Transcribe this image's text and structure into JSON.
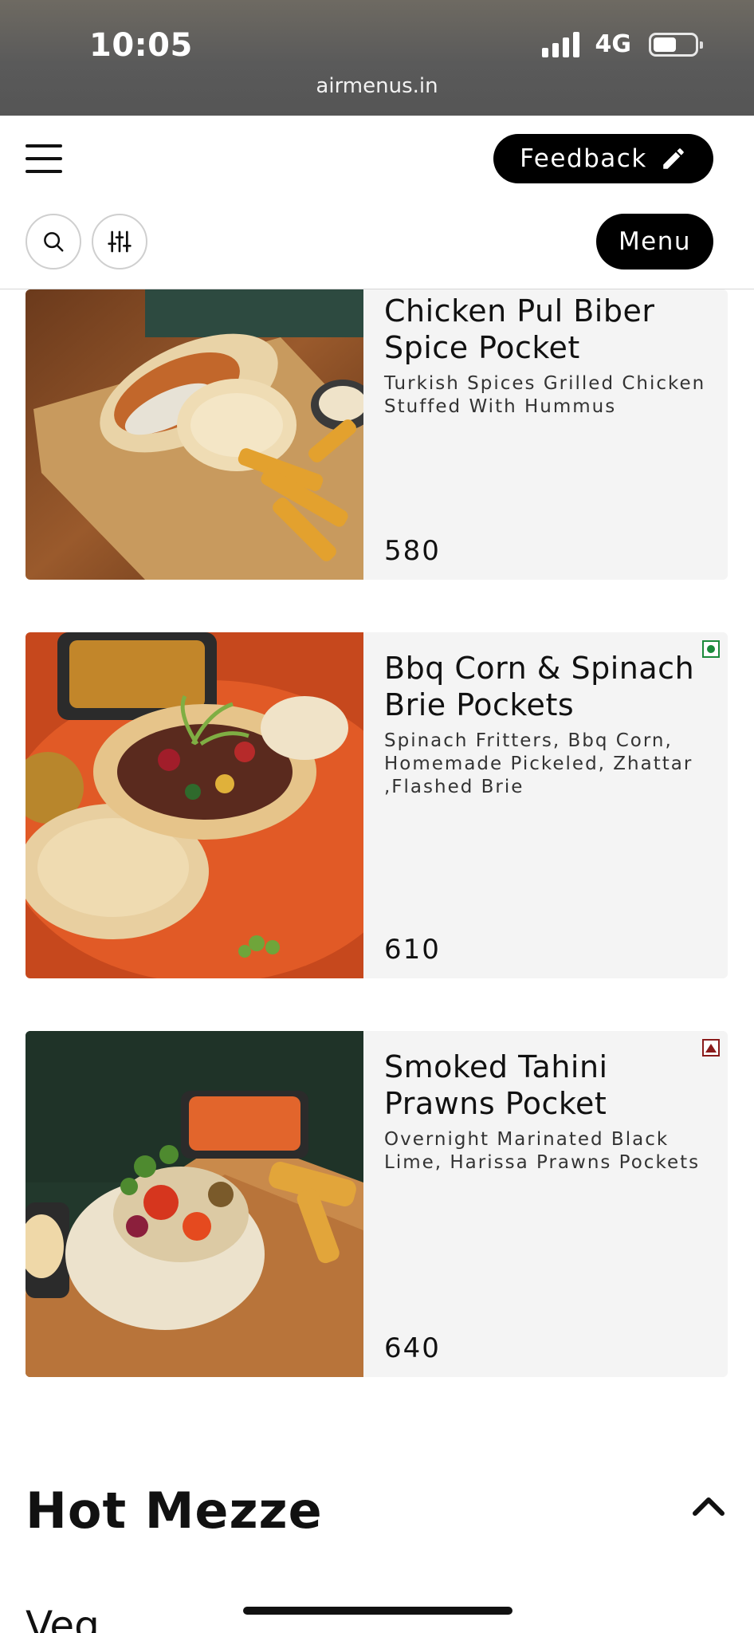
{
  "status_bar": {
    "time": "10:05",
    "network": "4G",
    "url": "airmenus.in",
    "icons": [
      "signal-bars-icon",
      "battery-icon"
    ]
  },
  "header": {
    "menu_icon": "hamburger-icon",
    "feedback_label": "Feedback",
    "feedback_icon": "pencil-icon",
    "search_icon": "search-icon",
    "filter_icon": "sliders-icon",
    "menu_label": "Menu"
  },
  "items": [
    {
      "name": "Chicken Pul Biber Spice Pocket",
      "description": "Turkish Spices Grilled Chicken Stuffed With Hummus",
      "price": "580",
      "diet": "none"
    },
    {
      "name": "Bbq Corn & Spinach Brie Pockets",
      "description": "Spinach Fritters, Bbq Corn, Homemade Pickeled, Zhattar ,Flashed Brie",
      "price": "610",
      "diet": "veg"
    },
    {
      "name": "Smoked Tahini Prawns Pocket",
      "description": "Overnight Marinated Black Lime, Harissa Prawns Pockets",
      "price": "640",
      "diet": "non-veg"
    }
  ],
  "section": {
    "title": "Hot Mezze",
    "toggle_icon": "chevron-up-icon",
    "subsection": "Veg"
  },
  "colors": {
    "veg": "#1b8a3b",
    "non_veg": "#8a1b1b",
    "card_bg": "#f4f4f4",
    "button_bg": "#000000"
  }
}
